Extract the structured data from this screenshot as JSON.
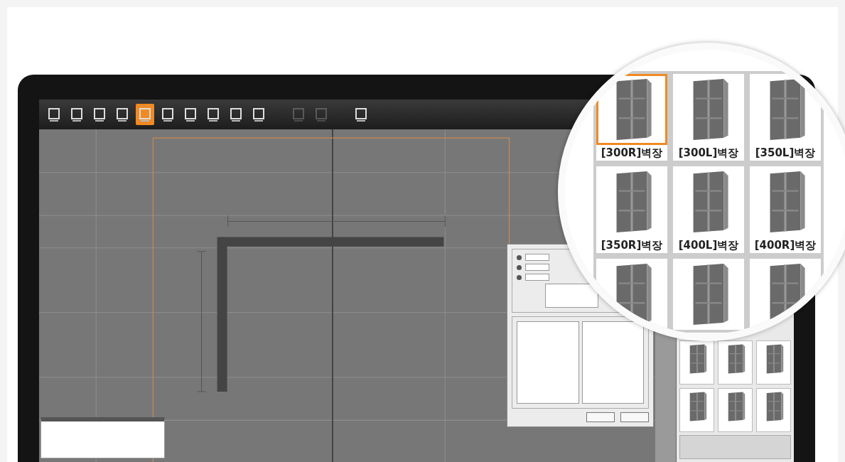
{
  "toolbar": {
    "buttons": [
      {
        "selected": false,
        "disabled": false
      },
      {
        "selected": false,
        "disabled": false
      },
      {
        "selected": false,
        "disabled": false
      },
      {
        "selected": false,
        "disabled": false
      },
      {
        "selected": true,
        "disabled": false
      },
      {
        "selected": false,
        "disabled": false
      },
      {
        "selected": false,
        "disabled": false
      },
      {
        "selected": false,
        "disabled": false
      },
      {
        "selected": false,
        "disabled": false
      },
      {
        "selected": false,
        "disabled": false
      },
      {
        "selected": false,
        "disabled": true
      },
      {
        "selected": false,
        "disabled": true
      },
      {
        "selected": false,
        "disabled": false
      }
    ]
  },
  "magnifier": {
    "tiles": [
      {
        "label": "[300R]벽장",
        "selected": true
      },
      {
        "label": "[300L]벽장",
        "selected": false
      },
      {
        "label": "[350L]벽장",
        "selected": false
      },
      {
        "label": "[350R]벽장",
        "selected": false
      },
      {
        "label": "[400L]벽장",
        "selected": false
      },
      {
        "label": "[400R]벽장",
        "selected": false
      },
      {
        "selected": false
      },
      {
        "selected": false
      },
      {
        "selected": false
      }
    ]
  }
}
